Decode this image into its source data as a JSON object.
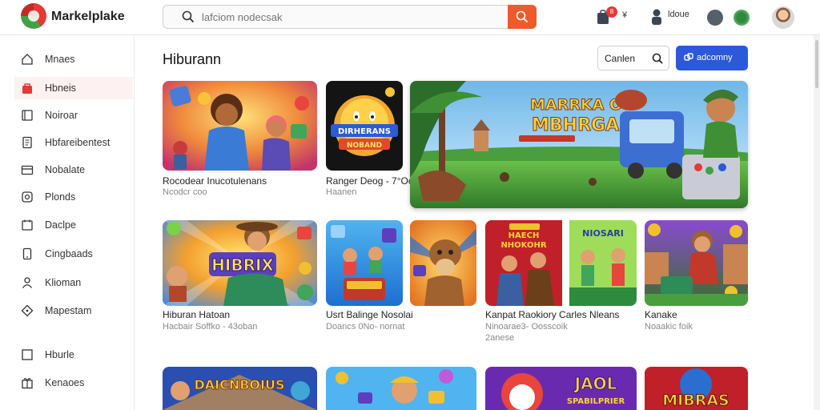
{
  "header": {
    "brand": "Markelplake",
    "search_placeholder": "lafciom nodecsak",
    "cart_badge": "8",
    "cart_label": "¥",
    "account_label": "ldoue",
    "icons": [
      "cart-icon",
      "user-icon",
      "settings-icon",
      "status-dot-icon"
    ]
  },
  "sidebar": {
    "items": [
      {
        "label": "Mnaes",
        "icon": "home-icon"
      },
      {
        "label": "Hbneis",
        "icon": "bag-icon",
        "active": true
      },
      {
        "label": "Noiroar",
        "icon": "book-icon"
      },
      {
        "label": "Hbfareibentest",
        "icon": "document-icon"
      },
      {
        "label": "Nobalate",
        "icon": "card-icon"
      },
      {
        "label": "Plonds",
        "icon": "clock-icon"
      },
      {
        "label": "Daclpe",
        "icon": "calendar-icon"
      },
      {
        "label": "Cingbaads",
        "icon": "phone-icon"
      },
      {
        "label": "Klioman",
        "icon": "person-icon"
      },
      {
        "label": "Mapestam",
        "icon": "tag-icon"
      },
      {
        "label": "Hburle",
        "icon": "square-icon"
      },
      {
        "label": "Kenaoes",
        "icon": "gift-icon"
      }
    ]
  },
  "main": {
    "title": "Hiburann",
    "genre_button": "Canlen",
    "primary_button": "adcomny",
    "row1": [
      {
        "title": "Rocodear Inucotulenans",
        "sub": "Ncodcr coo"
      },
      {
        "title": "Ranger Deog - 7°Oc",
        "sub": "Haanen",
        "art_text_1": "DIRHERANS",
        "art_text_2": "NOBAND"
      }
    ],
    "feature": {
      "art_text_1": "MARRKA OY",
      "art_text_2": "MBHRGAI"
    },
    "row2": [
      {
        "title": "Hiburan Hatoan",
        "sub": "Hacbair Soffko - 43oban",
        "art_text": "HIBRIX"
      },
      {
        "title": "Usrt Balinge Nosolai",
        "sub": "Doancs 0No- nornat"
      },
      {
        "title": "Kanpat Raokiory Carles Nleans",
        "sub": "Ninoarae3- Oosscoik",
        "sub2": "2anese",
        "art_text_1": "HAECH",
        "art_text_2": "NHOKOHR",
        "art_text_3": "NIOSARI"
      },
      {
        "title": "Kanake",
        "sub": "Noaakic foik"
      }
    ],
    "row3": [
      {
        "art_text": "DAICNBOIUS"
      },
      {},
      {
        "art_text_1": "JAOL",
        "art_text_2": "SPABILPRIER"
      },
      {
        "art_text": "MIBRAS"
      }
    ]
  },
  "colors": {
    "accent": "#ef5a2a",
    "primary": "#2b59d9",
    "active_bg": "#fdf1f1"
  }
}
